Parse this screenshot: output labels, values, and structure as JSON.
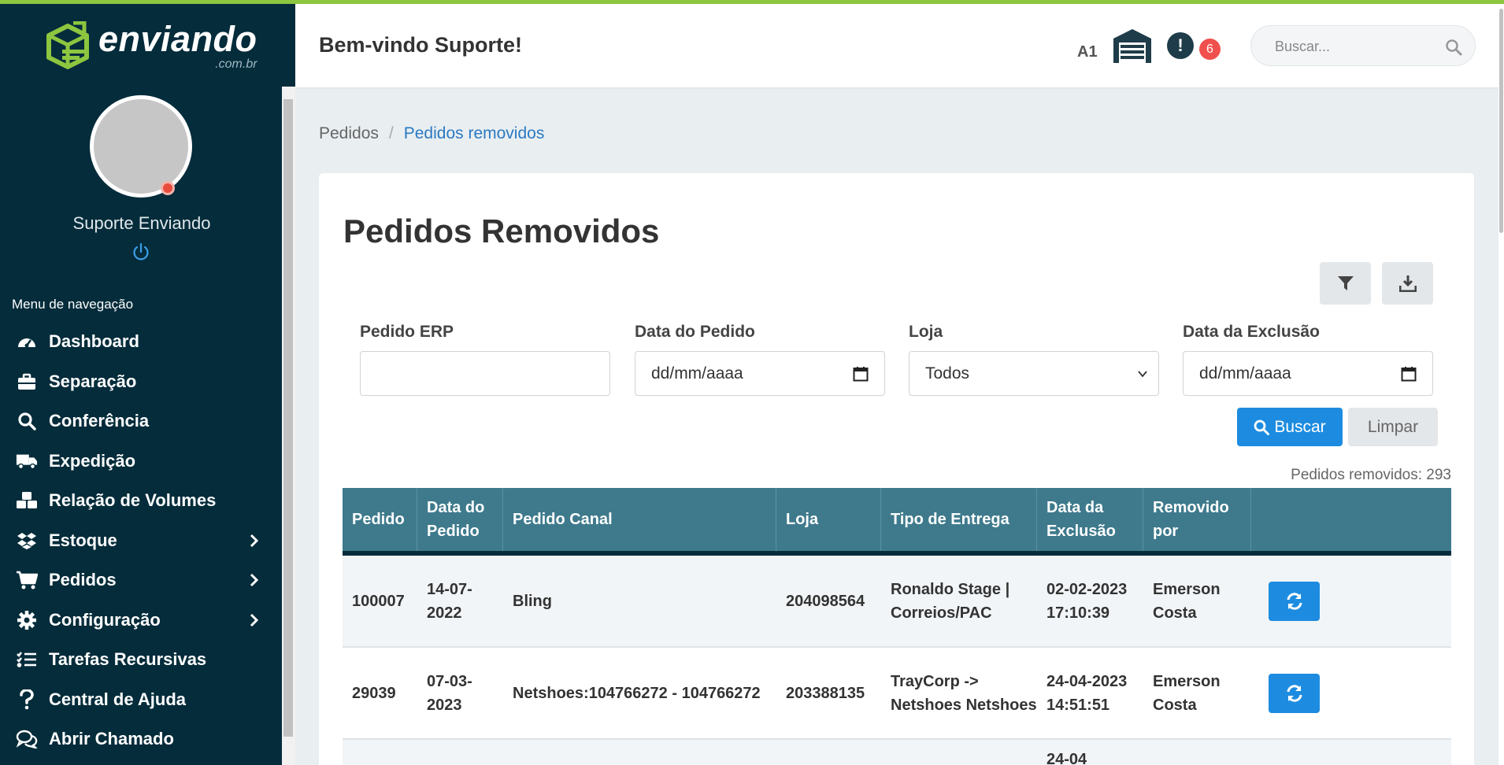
{
  "brand": {
    "name": "enviando",
    "domain": ".com.br",
    "accent": "#8dc63f",
    "sidebar_bg": "#042c3b"
  },
  "user": {
    "name": "Suporte Enviando"
  },
  "nav": {
    "title": "Menu de navegação",
    "items": [
      {
        "label": "Dashboard",
        "icon": "dashboard-icon",
        "has_children": false
      },
      {
        "label": "Separação",
        "icon": "briefcase-icon",
        "has_children": false
      },
      {
        "label": "Conferência",
        "icon": "search-icon",
        "has_children": false
      },
      {
        "label": "Expedição",
        "icon": "truck-icon",
        "has_children": false
      },
      {
        "label": "Relação de Volumes",
        "icon": "boxes-icon",
        "has_children": false
      },
      {
        "label": "Estoque",
        "icon": "dropbox-icon",
        "has_children": true
      },
      {
        "label": "Pedidos",
        "icon": "cart-icon",
        "has_children": true
      },
      {
        "label": "Configuração",
        "icon": "gear-icon",
        "has_children": true
      },
      {
        "label": "Tarefas Recursivas",
        "icon": "tasks-icon",
        "has_children": false
      },
      {
        "label": "Central de Ajuda",
        "icon": "question-icon",
        "has_children": false
      },
      {
        "label": "Abrir Chamado",
        "icon": "chat-icon",
        "has_children": false
      }
    ]
  },
  "header": {
    "welcome": "Bem-vindo Suporte!",
    "warehouse_code": "A1",
    "alert_glyph": "!",
    "notification_count": "6",
    "search_placeholder": "Buscar..."
  },
  "breadcrumb": {
    "first": "Pedidos",
    "separator": "/",
    "active": "Pedidos removidos"
  },
  "page": {
    "title": "Pedidos Removidos",
    "filters": {
      "pedido_erp": {
        "label": "Pedido ERP",
        "value": ""
      },
      "data_pedido": {
        "label": "Data do Pedido",
        "placeholder": "dd/mm/aaaa"
      },
      "loja": {
        "label": "Loja",
        "selected": "Todos"
      },
      "data_exclusao": {
        "label": "Data da Exclusão",
        "placeholder": "dd/mm/aaaa"
      }
    },
    "buttons": {
      "search": "Buscar",
      "clear": "Limpar"
    },
    "count_text": "Pedidos removidos: 293"
  },
  "table": {
    "headers": [
      "Pedido",
      "Data do Pedido",
      "Pedido Canal",
      "Loja",
      "Tipo de Entrega",
      "Data da Exclusão",
      "Removido por",
      ""
    ],
    "rows": [
      {
        "pedido": "100007",
        "data_pedido": "14-07-2022",
        "pedido_canal": "Bling",
        "loja": "204098564",
        "tipo_entrega": "Ronaldo Stage | Correios/PAC",
        "data_exclusao": "02-02-2023 17:10:39",
        "removido_por": "Emerson Costa"
      },
      {
        "pedido": "29039",
        "data_pedido": "07-03-2023",
        "pedido_canal": "Netshoes:104766272 - 104766272",
        "loja": "203388135",
        "tipo_entrega": "TrayCorp -> Netshoes Netshoes",
        "data_exclusao": "24-04-2023 14:51:51",
        "removido_por": "Emerson Costa"
      },
      {
        "pedido": "",
        "data_pedido": "",
        "pedido_canal": "",
        "loja": "",
        "tipo_entrega": "",
        "data_exclusao": "24-04",
        "removido_por": ""
      }
    ]
  }
}
